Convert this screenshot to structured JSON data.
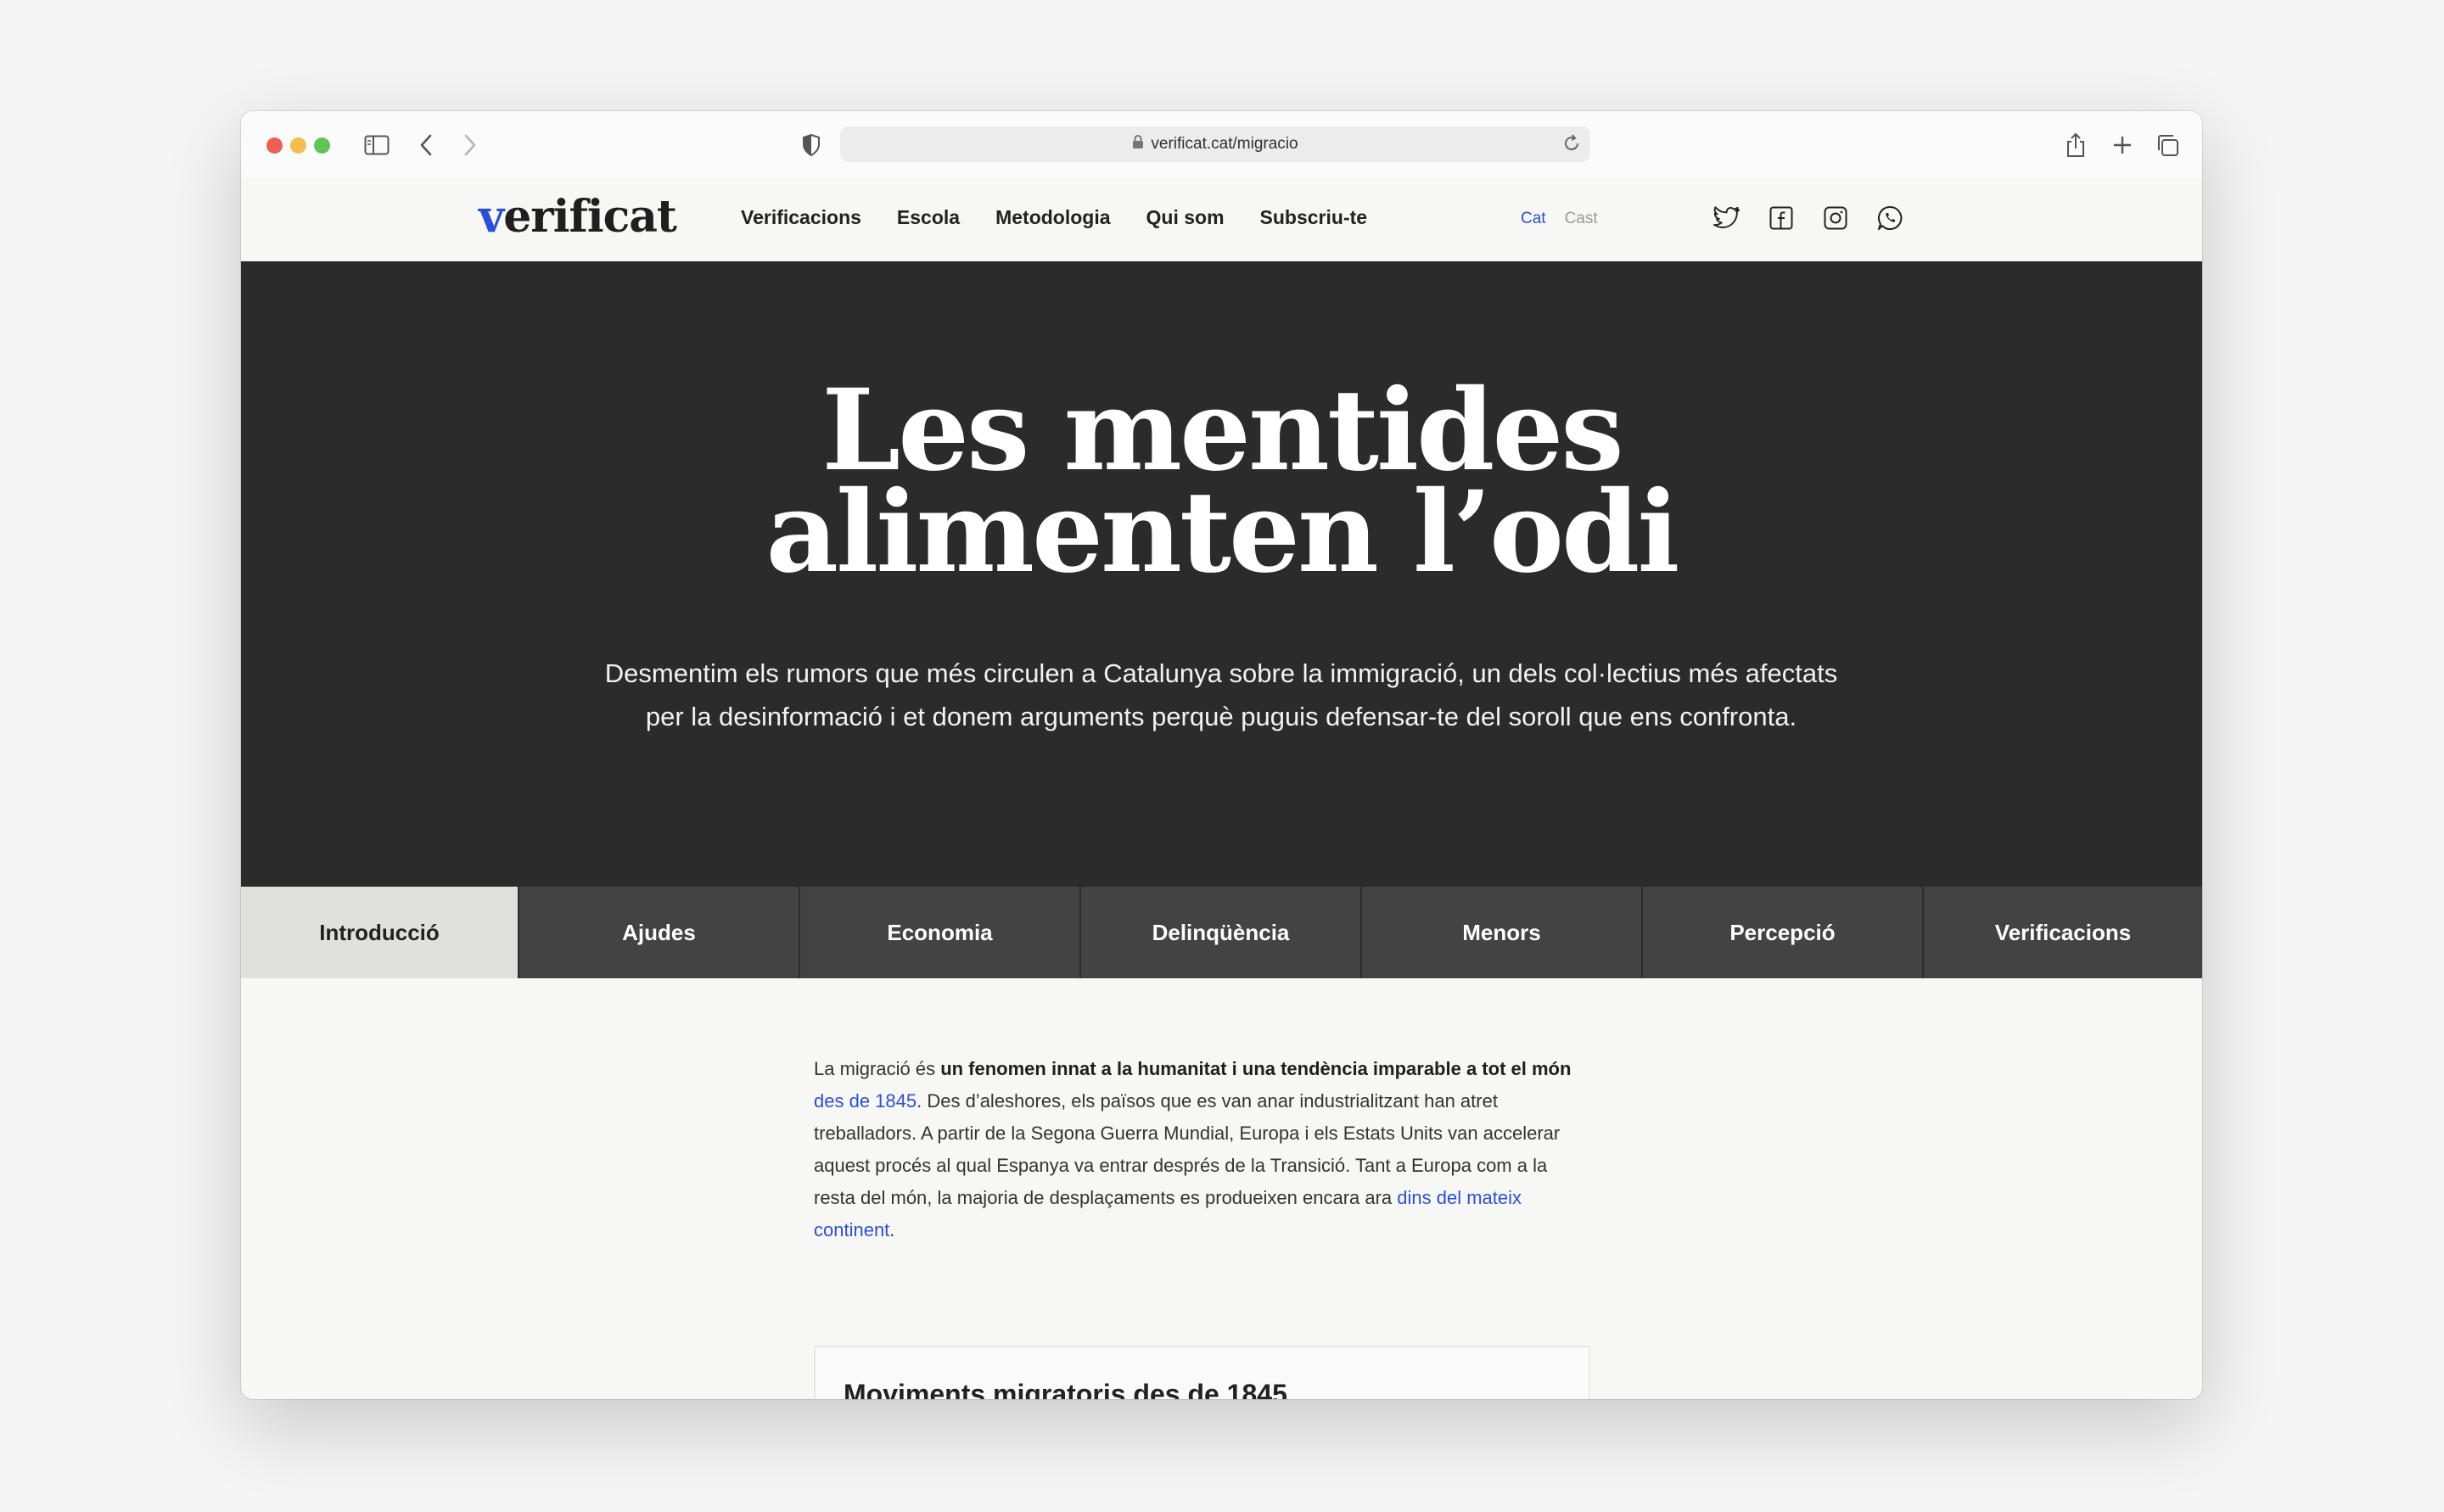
{
  "browser": {
    "url": "verificat.cat/migracio"
  },
  "header": {
    "logo_mark": "v",
    "logo_text": "erificat",
    "nav": [
      "Verificacions",
      "Escola",
      "Metodologia",
      "Qui som",
      "Subscriu-te"
    ],
    "languages": {
      "active": "Cat",
      "inactive": "Cast"
    },
    "social_icons": [
      "twitter-icon",
      "facebook-icon",
      "instagram-icon",
      "whatsapp-icon"
    ]
  },
  "hero": {
    "title_line1": "Les mentides",
    "title_line2": "alimenten l’odi",
    "subtitle": "Desmentim els rumors que més circulen a Catalunya sobre la immigració, un dels col·lectius més afectats per la desinformació i et donem arguments perquè puguis defensar-te del soroll que ens confronta."
  },
  "tabs": [
    {
      "label": "Introducció",
      "active": true
    },
    {
      "label": "Ajudes",
      "active": false
    },
    {
      "label": "Economia",
      "active": false
    },
    {
      "label": "Delinqüència",
      "active": false
    },
    {
      "label": "Menors",
      "active": false
    },
    {
      "label": "Percepció",
      "active": false
    },
    {
      "label": "Verificacions",
      "active": false
    }
  ],
  "article": {
    "p1_a": "La migració és ",
    "p1_bold": "un fenomen innat a la humanitat i una tendència imparable a tot el món",
    "p1_space": " ",
    "p1_link1": "des de 1845",
    "p1_b": ". Des d’aleshores, els països que es van anar industrialitzant han atret treballadors. A partir de la Segona Guerra Mundial, Europa i els Estats Units van accelerar aquest procés al qual Espanya va entrar després de la Transició. Tant a Europa com a la resta del món, la majoria de desplaçaments es produeixen encara ara ",
    "p1_link2": "dins del mateix continent",
    "p1_end": "."
  },
  "card": {
    "title": "Moviments migratoris des de 1845"
  },
  "colors": {
    "accent": "#2c4fd6",
    "hero_bg": "#2b2b2b",
    "tab_bg": "#434343",
    "tab_active_bg": "#e0e0de"
  }
}
